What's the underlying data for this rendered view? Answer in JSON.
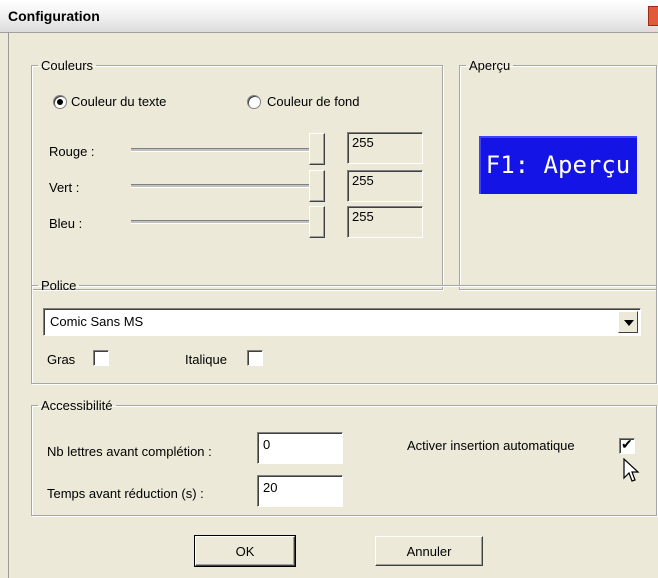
{
  "window": {
    "title": "Configuration"
  },
  "couleurs": {
    "legend": "Couleurs",
    "radio_text": "Couleur du texte",
    "radio_background": "Couleur de fond",
    "selected": "text",
    "sliders": [
      {
        "label": "Rouge :",
        "value": "255",
        "fraction": 1.0
      },
      {
        "label": "Vert :",
        "value": "255",
        "fraction": 1.0
      },
      {
        "label": "Bleu :",
        "value": "255",
        "fraction": 1.0
      }
    ]
  },
  "apercu": {
    "legend": "Aperçu",
    "preview_text": "F1: Aperçu",
    "preview_bg": "#1414e6",
    "preview_fg": "#ffffff"
  },
  "police": {
    "legend": "Police",
    "font_selected": "Comic Sans MS",
    "bold_label": "Gras",
    "bold_checked": false,
    "italic_label": "Italique",
    "italic_checked": false
  },
  "accessibilite": {
    "legend": "Accessibilité",
    "letters_label": "Nb lettres avant complétion :",
    "letters_value": "0",
    "time_label": "Temps avant réduction (s) :",
    "time_value": "20",
    "auto_insert_label": "Activer insertion automatique",
    "auto_insert_checked": true
  },
  "buttons": {
    "ok": "OK",
    "cancel": "Annuler"
  },
  "icons": {
    "close": "close-icon",
    "cursor": "mouse-pointer-icon",
    "dropdown": "chevron-down-icon"
  }
}
